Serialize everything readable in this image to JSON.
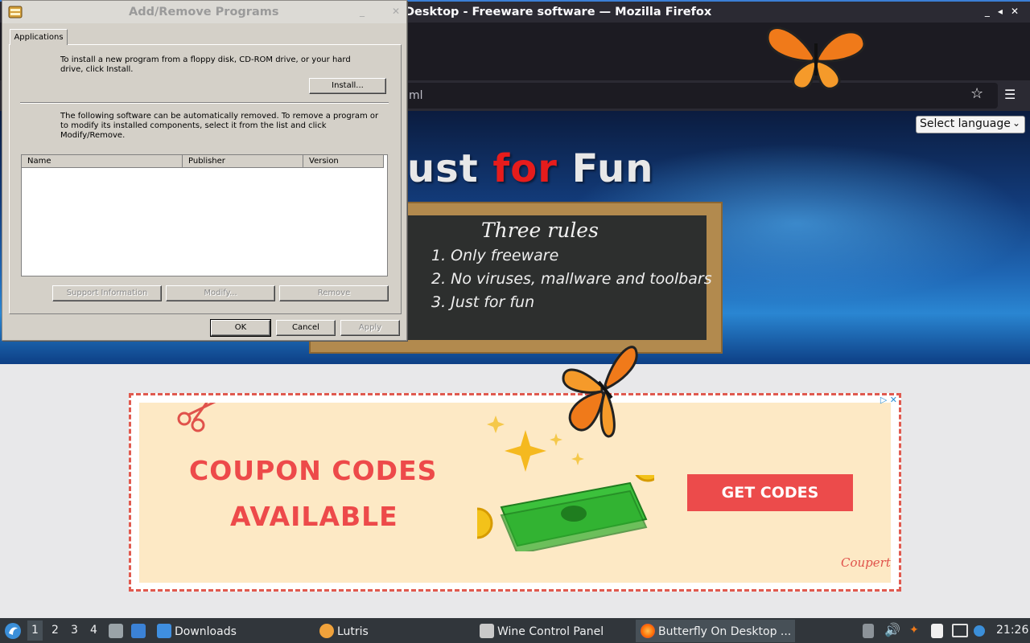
{
  "firefox": {
    "title": "Desktop - Freeware software — Mozilla Firefox",
    "url_fragment": "ml",
    "window_buttons": [
      "_",
      "◂",
      "✕"
    ]
  },
  "page": {
    "language_select": "Select language",
    "banner": {
      "part1": "ust ",
      "part2": "for",
      "part3": " Fun"
    },
    "chalkboard": {
      "title": "Three rules",
      "rules": [
        "1. Only freeware",
        "2. No viruses, mallware and toolbars",
        "3. Just for fun"
      ]
    }
  },
  "ad": {
    "line1": "COUPON CODES",
    "line2": "AVAILABLE",
    "button": "GET CODES",
    "brand": "Coupert",
    "adchoices": "▷ ✕"
  },
  "wine_dialog": {
    "title": "Add/Remove Programs",
    "tab": "Applications",
    "install_text": "To install a new program from a floppy disk, CD-ROM drive, or your hard drive, click Install.",
    "install_button": "Install...",
    "remove_text": "The following software can be automatically removed. To remove a program or to modify its installed components, select it from the list and click Modify/Remove.",
    "columns": [
      "Name",
      "Publisher",
      "Version"
    ],
    "support_button": "Support Information",
    "modify_button": "Modify...",
    "remove_button": "Remove",
    "ok_button": "OK",
    "cancel_button": "Cancel",
    "apply_button": "Apply"
  },
  "taskbar": {
    "workspaces": [
      "1",
      "2",
      "3",
      "4"
    ],
    "items": [
      "Downloads",
      "Lutris",
      "Wine Control Panel",
      "Butterfly On Desktop ..."
    ],
    "clock": "21:26"
  },
  "colors": {
    "ad_red": "#ec4b4b",
    "taskbar": "#31363b",
    "wine_face": "#d4d0c8"
  }
}
